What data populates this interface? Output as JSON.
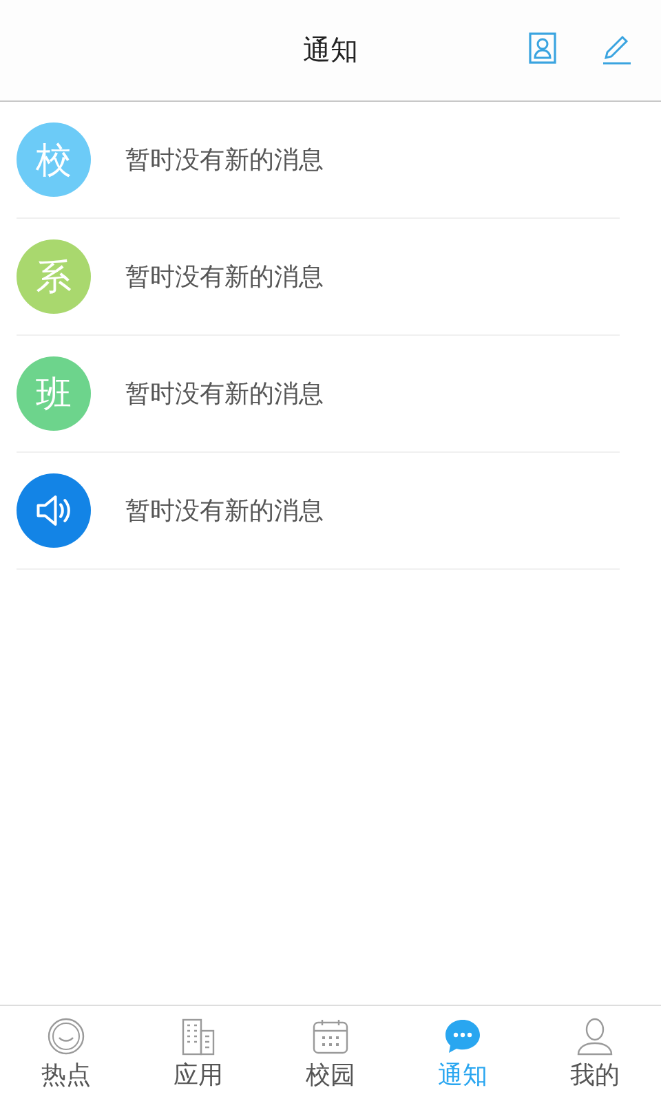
{
  "header": {
    "title": "通知"
  },
  "notices": [
    {
      "kind": "text",
      "badge": "校",
      "color": "#6ccbf7",
      "message": "暂时没有新的消息"
    },
    {
      "kind": "text",
      "badge": "系",
      "color": "#a9d86e",
      "message": "暂时没有新的消息"
    },
    {
      "kind": "text",
      "badge": "班",
      "color": "#6dd48c",
      "message": "暂时没有新的消息"
    },
    {
      "kind": "speaker",
      "color": "#1384e6",
      "message": "暂时没有新的消息"
    }
  ],
  "tabs": [
    {
      "kind": "smile",
      "label": "热点",
      "selected": false
    },
    {
      "kind": "buildings",
      "label": "应用",
      "selected": false
    },
    {
      "kind": "calendar",
      "label": "校园",
      "selected": false
    },
    {
      "kind": "chat",
      "label": "通知",
      "selected": true
    },
    {
      "kind": "person",
      "label": "我的",
      "selected": false
    }
  ]
}
